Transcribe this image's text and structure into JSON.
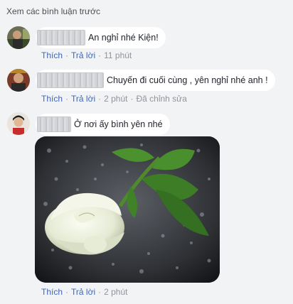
{
  "view_previous": "Xem các bình luận trước",
  "comments": [
    {
      "text": "An nghỉ nhé Kiện!",
      "like": "Thích",
      "reply": "Trả lời",
      "time": "11 phút"
    },
    {
      "text": "Chuyến đi cuối cùng , yên nghỉ nhé anh !",
      "like": "Thích",
      "reply": "Trả lời",
      "time": "2 phút",
      "edited": "Đã chỉnh sửa"
    },
    {
      "text": "Ở nơi ấy bình yên nhé",
      "like": "Thích",
      "reply": "Trả lời",
      "time": "2 phút"
    }
  ],
  "colors": {
    "background": "#f2f3f5",
    "bubble": "#ffffff",
    "link": "#4267b2",
    "meta": "#90949c"
  }
}
